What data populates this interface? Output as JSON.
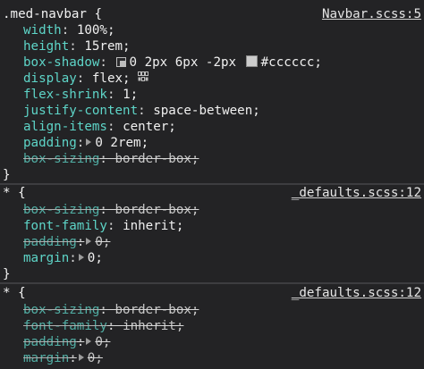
{
  "rules": [
    {
      "selector": ".med-navbar {",
      "source": "Navbar.scss:5",
      "close": "}",
      "decls": [
        {
          "prop": "width",
          "value": "100%;"
        },
        {
          "prop": "height",
          "value": "15rem;"
        },
        {
          "prop": "box-shadow",
          "value": "0 2px 6px -2px #cccccc;",
          "swatch": "#cccccc"
        },
        {
          "prop": "display",
          "value": "flex;"
        },
        {
          "prop": "flex-shrink",
          "value": "1;"
        },
        {
          "prop": "justify-content",
          "value": "space-between;"
        },
        {
          "prop": "align-items",
          "value": "center;"
        },
        {
          "prop": "padding",
          "value": "0 2rem;"
        },
        {
          "prop": "box-sizing",
          "value": "border-box;"
        }
      ]
    },
    {
      "selector": "* {",
      "source": "_defaults.scss:12",
      "close": "}",
      "decls": [
        {
          "prop": "box-sizing",
          "value": "border-box;"
        },
        {
          "prop": "font-family",
          "value": "inherit;"
        },
        {
          "prop": "padding",
          "value": "0;"
        },
        {
          "prop": "margin",
          "value": "0;"
        }
      ]
    },
    {
      "selector": "* {",
      "source": "_defaults.scss:12",
      "decls": [
        {
          "prop": "box-sizing",
          "value": "border-box;"
        },
        {
          "prop": "font-family",
          "value": "inherit;"
        },
        {
          "prop": "padding",
          "value": "0;"
        },
        {
          "prop": "margin",
          "value": "0;"
        }
      ]
    }
  ]
}
